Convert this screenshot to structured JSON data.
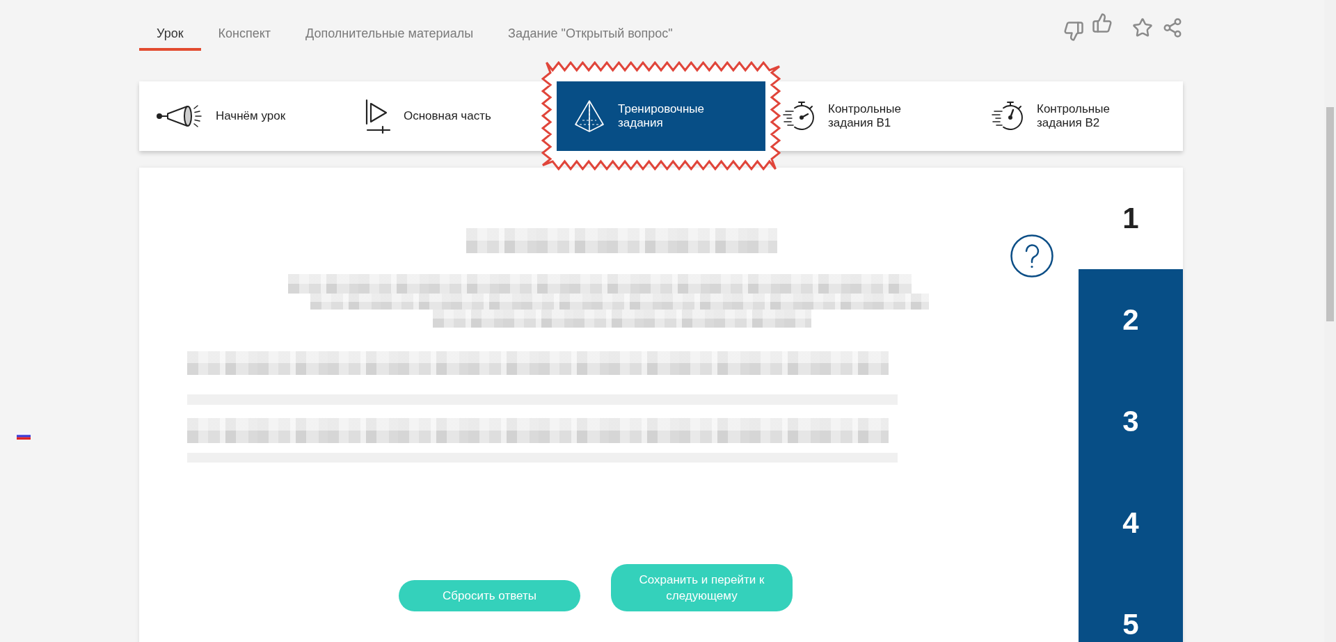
{
  "tabs": [
    {
      "label": "Урок",
      "selected": true
    },
    {
      "label": "Конспект",
      "selected": false
    },
    {
      "label": "Дополнительные материалы",
      "selected": false
    },
    {
      "label": "Задание \"Открытый вопрос\"",
      "selected": false
    }
  ],
  "steps": [
    {
      "kind": "intro",
      "label": "Начнём урок",
      "selected": false,
      "highlighted": false
    },
    {
      "kind": "main",
      "label": "Основная часть",
      "selected": false,
      "highlighted": false
    },
    {
      "kind": "training",
      "label": "Тренировочные задания",
      "selected": true,
      "highlighted": true
    },
    {
      "kind": "control",
      "label": "Контрольные задания В1",
      "selected": false,
      "highlighted": false
    },
    {
      "kind": "control_alt",
      "label": "Контрольные задания В2",
      "selected": false,
      "highlighted": false
    }
  ],
  "task_numbers": [
    {
      "label": "1",
      "selected": true
    },
    {
      "label": "2",
      "selected": false
    },
    {
      "label": "3",
      "selected": false
    },
    {
      "label": "4",
      "selected": false
    },
    {
      "label": "5",
      "selected": false
    }
  ],
  "buttons": [
    "Сбросить ответы",
    "Сохранить и перейти к следующему"
  ]
}
